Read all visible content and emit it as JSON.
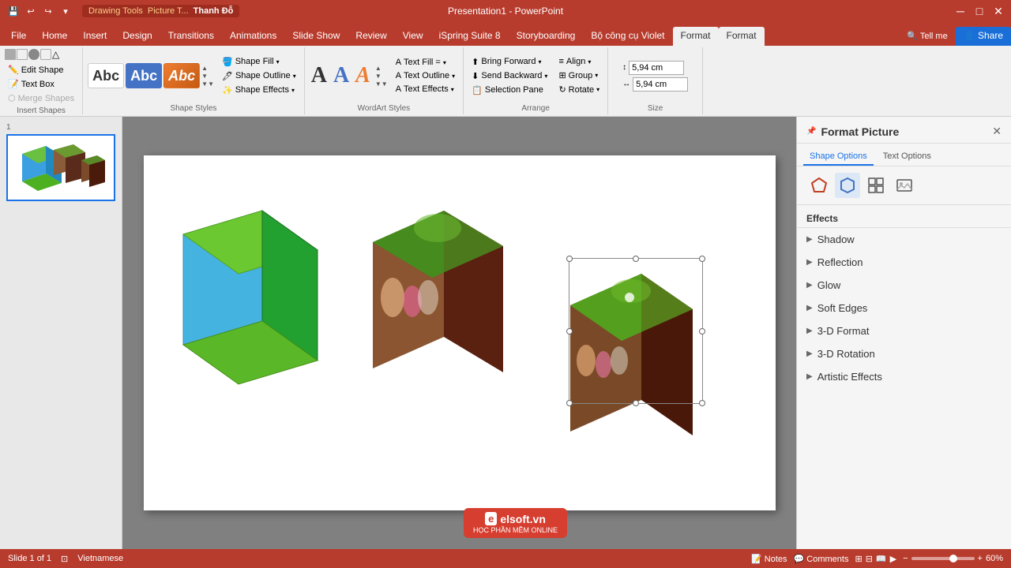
{
  "titlebar": {
    "title": "Presentation1 - PowerPoint",
    "tabs_left": [
      "Drawing Tools",
      "Picture T...",
      "Thanh Đỗ"
    ],
    "close_label": "✕",
    "minimize_label": "─",
    "maximize_label": "□",
    "pin_label": "📌"
  },
  "ribbon_tabs": [
    {
      "label": "File",
      "active": false
    },
    {
      "label": "Home",
      "active": false
    },
    {
      "label": "Insert",
      "active": false
    },
    {
      "label": "Design",
      "active": false
    },
    {
      "label": "Transitions",
      "active": false
    },
    {
      "label": "Animations",
      "active": false
    },
    {
      "label": "Slide Show",
      "active": false
    },
    {
      "label": "Review",
      "active": false
    },
    {
      "label": "View",
      "active": false
    },
    {
      "label": "iSpring Suite 8",
      "active": false
    },
    {
      "label": "Storyboarding",
      "active": false
    },
    {
      "label": "Bộ công cụ Violet",
      "active": false
    },
    {
      "label": "Format",
      "active": true
    },
    {
      "label": "Format",
      "active": true
    },
    {
      "label": "Tell me",
      "active": false
    },
    {
      "label": "Share",
      "active": false
    }
  ],
  "ribbon": {
    "insert_shapes_label": "Insert Shapes",
    "shape_styles_label": "Shape Styles",
    "wordart_styles_label": "WordArt Styles",
    "arrange_label": "Arrange",
    "size_label": "Size",
    "edit_shape_label": "Edit Shape",
    "text_box_label": "Text Box",
    "merge_shapes_label": "Merge Shapes",
    "shape_fill_label": "Shape Fill",
    "shape_outline_label": "Shape Outline",
    "shape_effects_label": "Shape Effects",
    "text_fill_label": "Text Fill =",
    "text_outline_label": "Text Outline",
    "text_effects_label": "Text Effects",
    "bring_forward_label": "Bring Forward",
    "send_backward_label": "Send Backward",
    "selection_pane_label": "Selection Pane",
    "align_label": "Align",
    "group_label": "Group",
    "rotate_label": "Rotate",
    "style1": "Abc",
    "style2": "Abc",
    "style3": "Abc",
    "size_width": "5,94 cm",
    "size_height": "5,94 cm"
  },
  "format_panel": {
    "title": "Format Picture",
    "tab1": "Shape Options",
    "tab2": "Text Options",
    "effects_header": "Effects",
    "effects": [
      {
        "label": "Shadow"
      },
      {
        "label": "Reflection"
      },
      {
        "label": "Glow"
      },
      {
        "label": "Soft Edges"
      },
      {
        "label": "3-D Format"
      },
      {
        "label": "3-D Rotation"
      },
      {
        "label": "Artistic Effects"
      }
    ]
  },
  "status": {
    "slide_info": "Slide 1 of 1",
    "language": "Vietnamese",
    "notes_label": "Notes",
    "comments_label": "Comments",
    "zoom_label": "60%"
  },
  "slide": {
    "bg_color": "#ffffff"
  }
}
